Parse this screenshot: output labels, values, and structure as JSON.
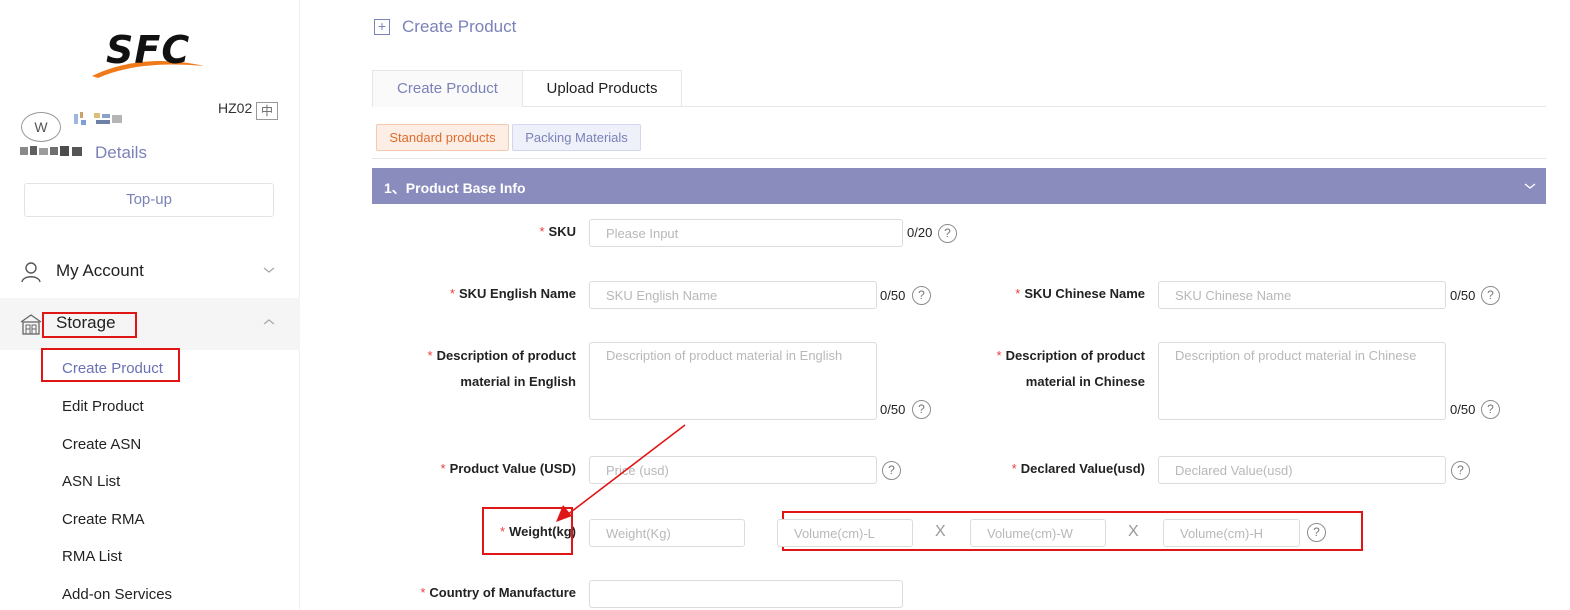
{
  "brand": {
    "logo_text": "SFC",
    "swoosh_color": "#f07a1a"
  },
  "user": {
    "avatar_initial": "W",
    "warehouse_code": "HZ02",
    "lang_toggle": "中",
    "details_label": "Details",
    "topup_label": "Top-up"
  },
  "sidebar": {
    "my_account": "My Account",
    "storage": "Storage",
    "storage_items": [
      "Create Product",
      "Edit Product",
      "Create ASN",
      "ASN List",
      "Create RMA",
      "RMA List",
      "Add-on Services"
    ],
    "active_item": "Create Product"
  },
  "page": {
    "title_icon": "plus-square-icon",
    "title": "Create Product",
    "tabs": [
      "Create Product",
      "Upload Products"
    ],
    "active_tab": "Create Product",
    "chips": [
      "Standard products",
      "Packing Materials"
    ],
    "active_chip": "Standard products"
  },
  "section": {
    "title": "1、Product Base Info"
  },
  "form": {
    "sku": {
      "label": "SKU",
      "placeholder": "Please Input",
      "counter": "0/20"
    },
    "sku_en": {
      "label": "SKU English Name",
      "placeholder": "SKU English Name",
      "counter": "0/50"
    },
    "sku_cn": {
      "label": "SKU Chinese Name",
      "placeholder": "SKU Chinese Name",
      "counter": "0/50"
    },
    "desc_en": {
      "label_line1": "Description of product",
      "label_line2": "material in English",
      "placeholder": "Description of product material in English",
      "counter": "0/50"
    },
    "desc_cn": {
      "label_line1": "Description of product",
      "label_line2": "material in Chinese",
      "placeholder": "Description of product material in Chinese",
      "counter": "0/50"
    },
    "product_value": {
      "label": "Product Value (USD)",
      "placeholder": "Price (usd)"
    },
    "declared_value": {
      "label": "Declared Value(usd)",
      "placeholder": "Declared Value(usd)"
    },
    "weight": {
      "label": "Weight(kg)",
      "placeholder": "Weight(Kg)"
    },
    "volume": {
      "length_placeholder": "Volume(cm)-L",
      "width_placeholder": "Volume(cm)-W",
      "height_placeholder": "Volume(cm)-H",
      "separator": "X"
    },
    "country": {
      "label": "Country of Manufacture"
    },
    "required_mark": "*",
    "help_glyph": "?"
  },
  "colors": {
    "accent": "#7b82b8",
    "section_bar": "#8a8cbd",
    "annotation_red": "#e01515",
    "chip_orange": "#e06b2c"
  }
}
